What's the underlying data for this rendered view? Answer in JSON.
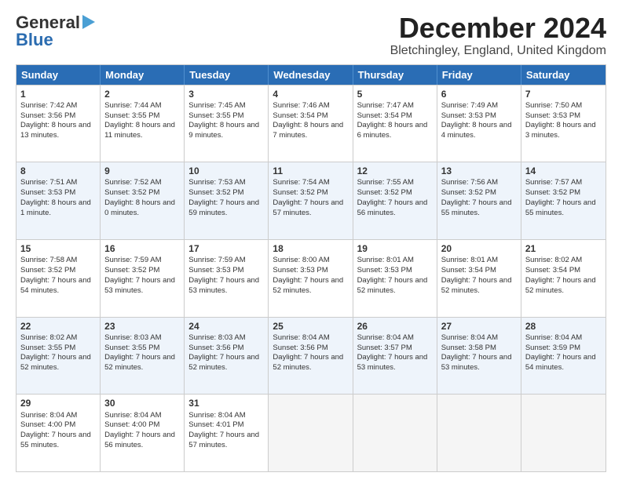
{
  "logo": {
    "line1": "General",
    "line2": "Blue"
  },
  "title": "December 2024",
  "subtitle": "Bletchingley, England, United Kingdom",
  "headers": [
    "Sunday",
    "Monday",
    "Tuesday",
    "Wednesday",
    "Thursday",
    "Friday",
    "Saturday"
  ],
  "rows": [
    [
      {
        "day": "1",
        "sunrise": "Sunrise: 7:42 AM",
        "sunset": "Sunset: 3:56 PM",
        "daylight": "Daylight: 8 hours and 13 minutes."
      },
      {
        "day": "2",
        "sunrise": "Sunrise: 7:44 AM",
        "sunset": "Sunset: 3:55 PM",
        "daylight": "Daylight: 8 hours and 11 minutes."
      },
      {
        "day": "3",
        "sunrise": "Sunrise: 7:45 AM",
        "sunset": "Sunset: 3:55 PM",
        "daylight": "Daylight: 8 hours and 9 minutes."
      },
      {
        "day": "4",
        "sunrise": "Sunrise: 7:46 AM",
        "sunset": "Sunset: 3:54 PM",
        "daylight": "Daylight: 8 hours and 7 minutes."
      },
      {
        "day": "5",
        "sunrise": "Sunrise: 7:47 AM",
        "sunset": "Sunset: 3:54 PM",
        "daylight": "Daylight: 8 hours and 6 minutes."
      },
      {
        "day": "6",
        "sunrise": "Sunrise: 7:49 AM",
        "sunset": "Sunset: 3:53 PM",
        "daylight": "Daylight: 8 hours and 4 minutes."
      },
      {
        "day": "7",
        "sunrise": "Sunrise: 7:50 AM",
        "sunset": "Sunset: 3:53 PM",
        "daylight": "Daylight: 8 hours and 3 minutes."
      }
    ],
    [
      {
        "day": "8",
        "sunrise": "Sunrise: 7:51 AM",
        "sunset": "Sunset: 3:53 PM",
        "daylight": "Daylight: 8 hours and 1 minute."
      },
      {
        "day": "9",
        "sunrise": "Sunrise: 7:52 AM",
        "sunset": "Sunset: 3:52 PM",
        "daylight": "Daylight: 8 hours and 0 minutes."
      },
      {
        "day": "10",
        "sunrise": "Sunrise: 7:53 AM",
        "sunset": "Sunset: 3:52 PM",
        "daylight": "Daylight: 7 hours and 59 minutes."
      },
      {
        "day": "11",
        "sunrise": "Sunrise: 7:54 AM",
        "sunset": "Sunset: 3:52 PM",
        "daylight": "Daylight: 7 hours and 57 minutes."
      },
      {
        "day": "12",
        "sunrise": "Sunrise: 7:55 AM",
        "sunset": "Sunset: 3:52 PM",
        "daylight": "Daylight: 7 hours and 56 minutes."
      },
      {
        "day": "13",
        "sunrise": "Sunrise: 7:56 AM",
        "sunset": "Sunset: 3:52 PM",
        "daylight": "Daylight: 7 hours and 55 minutes."
      },
      {
        "day": "14",
        "sunrise": "Sunrise: 7:57 AM",
        "sunset": "Sunset: 3:52 PM",
        "daylight": "Daylight: 7 hours and 55 minutes."
      }
    ],
    [
      {
        "day": "15",
        "sunrise": "Sunrise: 7:58 AM",
        "sunset": "Sunset: 3:52 PM",
        "daylight": "Daylight: 7 hours and 54 minutes."
      },
      {
        "day": "16",
        "sunrise": "Sunrise: 7:59 AM",
        "sunset": "Sunset: 3:52 PM",
        "daylight": "Daylight: 7 hours and 53 minutes."
      },
      {
        "day": "17",
        "sunrise": "Sunrise: 7:59 AM",
        "sunset": "Sunset: 3:53 PM",
        "daylight": "Daylight: 7 hours and 53 minutes."
      },
      {
        "day": "18",
        "sunrise": "Sunrise: 8:00 AM",
        "sunset": "Sunset: 3:53 PM",
        "daylight": "Daylight: 7 hours and 52 minutes."
      },
      {
        "day": "19",
        "sunrise": "Sunrise: 8:01 AM",
        "sunset": "Sunset: 3:53 PM",
        "daylight": "Daylight: 7 hours and 52 minutes."
      },
      {
        "day": "20",
        "sunrise": "Sunrise: 8:01 AM",
        "sunset": "Sunset: 3:54 PM",
        "daylight": "Daylight: 7 hours and 52 minutes."
      },
      {
        "day": "21",
        "sunrise": "Sunrise: 8:02 AM",
        "sunset": "Sunset: 3:54 PM",
        "daylight": "Daylight: 7 hours and 52 minutes."
      }
    ],
    [
      {
        "day": "22",
        "sunrise": "Sunrise: 8:02 AM",
        "sunset": "Sunset: 3:55 PM",
        "daylight": "Daylight: 7 hours and 52 minutes."
      },
      {
        "day": "23",
        "sunrise": "Sunrise: 8:03 AM",
        "sunset": "Sunset: 3:55 PM",
        "daylight": "Daylight: 7 hours and 52 minutes."
      },
      {
        "day": "24",
        "sunrise": "Sunrise: 8:03 AM",
        "sunset": "Sunset: 3:56 PM",
        "daylight": "Daylight: 7 hours and 52 minutes."
      },
      {
        "day": "25",
        "sunrise": "Sunrise: 8:04 AM",
        "sunset": "Sunset: 3:56 PM",
        "daylight": "Daylight: 7 hours and 52 minutes."
      },
      {
        "day": "26",
        "sunrise": "Sunrise: 8:04 AM",
        "sunset": "Sunset: 3:57 PM",
        "daylight": "Daylight: 7 hours and 53 minutes."
      },
      {
        "day": "27",
        "sunrise": "Sunrise: 8:04 AM",
        "sunset": "Sunset: 3:58 PM",
        "daylight": "Daylight: 7 hours and 53 minutes."
      },
      {
        "day": "28",
        "sunrise": "Sunrise: 8:04 AM",
        "sunset": "Sunset: 3:59 PM",
        "daylight": "Daylight: 7 hours and 54 minutes."
      }
    ],
    [
      {
        "day": "29",
        "sunrise": "Sunrise: 8:04 AM",
        "sunset": "Sunset: 4:00 PM",
        "daylight": "Daylight: 7 hours and 55 minutes."
      },
      {
        "day": "30",
        "sunrise": "Sunrise: 8:04 AM",
        "sunset": "Sunset: 4:00 PM",
        "daylight": "Daylight: 7 hours and 56 minutes."
      },
      {
        "day": "31",
        "sunrise": "Sunrise: 8:04 AM",
        "sunset": "Sunset: 4:01 PM",
        "daylight": "Daylight: 7 hours and 57 minutes."
      },
      null,
      null,
      null,
      null
    ]
  ]
}
